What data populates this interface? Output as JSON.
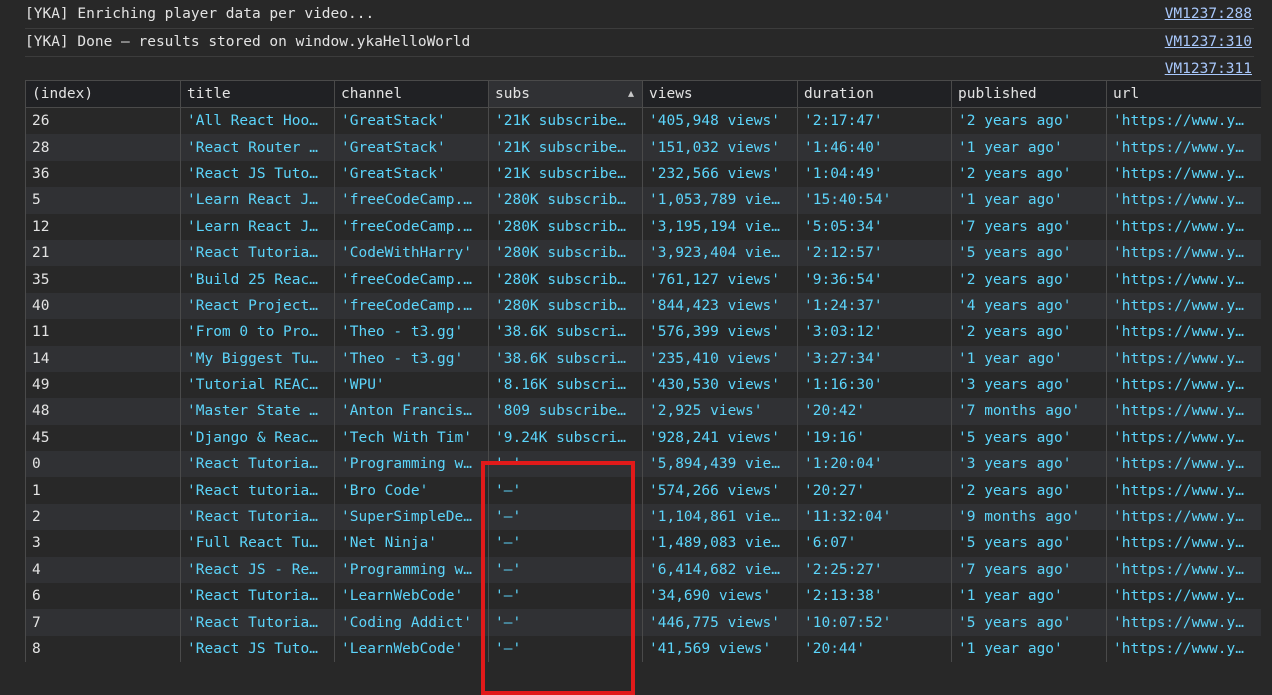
{
  "console": {
    "lines": [
      {
        "text": "[YKA] Enriching player data per video...",
        "source": "VM1237:288"
      },
      {
        "text": "[YKA] Done — results stored on window.ykaHelloWorld",
        "source": "VM1237:310"
      },
      {
        "text": "",
        "source": "VM1237:311"
      }
    ]
  },
  "table": {
    "columns": [
      "(index)",
      "title",
      "channel",
      "subs",
      "views",
      "duration",
      "published",
      "url"
    ],
    "sorted_column": "subs",
    "sort_direction": "ascending",
    "rows": [
      [
        "26",
        "'All React Hoo…",
        "'GreatStack'",
        "'21K subscribe…",
        "'405,948 views'",
        "'2:17:47'",
        "'2 years ago'",
        "'https://www.y…"
      ],
      [
        "28",
        "'React Router …",
        "'GreatStack'",
        "'21K subscribe…",
        "'151,032 views'",
        "'1:46:40'",
        "'1 year ago'",
        "'https://www.y…"
      ],
      [
        "36",
        "'React JS Tuto…",
        "'GreatStack'",
        "'21K subscribe…",
        "'232,566 views'",
        "'1:04:49'",
        "'2 years ago'",
        "'https://www.y…"
      ],
      [
        "5",
        "'Learn React J…",
        "'freeCodeCamp.…",
        "'280K subscrib…",
        "'1,053,789 vie…",
        "'15:40:54'",
        "'1 year ago'",
        "'https://www.y…"
      ],
      [
        "12",
        "'Learn React J…",
        "'freeCodeCamp.…",
        "'280K subscrib…",
        "'3,195,194 vie…",
        "'5:05:34'",
        "'7 years ago'",
        "'https://www.y…"
      ],
      [
        "21",
        "'React Tutoria…",
        "'CodeWithHarry'",
        "'280K subscrib…",
        "'3,923,404 vie…",
        "'2:12:57'",
        "'5 years ago'",
        "'https://www.y…"
      ],
      [
        "35",
        "'Build 25 Reac…",
        "'freeCodeCamp.…",
        "'280K subscrib…",
        "'761,127 views'",
        "'9:36:54'",
        "'2 years ago'",
        "'https://www.y…"
      ],
      [
        "40",
        "'React Project…",
        "'freeCodeCamp.…",
        "'280K subscrib…",
        "'844,423 views'",
        "'1:24:37'",
        "'4 years ago'",
        "'https://www.y…"
      ],
      [
        "11",
        "'From 0 to Pro…",
        "'Theo - t3.gg'",
        "'38.6K subscri…",
        "'576,399 views'",
        "'3:03:12'",
        "'2 years ago'",
        "'https://www.y…"
      ],
      [
        "14",
        "'My Biggest Tu…",
        "'Theo - t3.gg'",
        "'38.6K subscri…",
        "'235,410 views'",
        "'3:27:34'",
        "'1 year ago'",
        "'https://www.y…"
      ],
      [
        "49",
        "'Tutorial REAC…",
        "'WPU'",
        "'8.16K subscri…",
        "'430,530 views'",
        "'1:16:30'",
        "'3 years ago'",
        "'https://www.y…"
      ],
      [
        "48",
        "'Master State …",
        "'Anton Francis…",
        "'809 subscribe…",
        "'2,925 views'",
        "'20:42'",
        "'7 months ago'",
        "'https://www.y…"
      ],
      [
        "45",
        "'Django & Reac…",
        "'Tech With Tim'",
        "'9.24K subscri…",
        "'928,241 views'",
        "'19:16'",
        "'5 years ago'",
        "'https://www.y…"
      ],
      [
        "0",
        "'React Tutoria…",
        "'Programming w…",
        "'—'",
        "'5,894,439 vie…",
        "'1:20:04'",
        "'3 years ago'",
        "'https://www.y…"
      ],
      [
        "1",
        "'React tutoria…",
        "'Bro Code'",
        "'—'",
        "'574,266 views'",
        "'20:27'",
        "'2 years ago'",
        "'https://www.y…"
      ],
      [
        "2",
        "'React Tutoria…",
        "'SuperSimpleDe…",
        "'—'",
        "'1,104,861 vie…",
        "'11:32:04'",
        "'9 months ago'",
        "'https://www.y…"
      ],
      [
        "3",
        "'Full React Tu…",
        "'Net Ninja'",
        "'—'",
        "'1,489,083 vie…",
        "'6:07'",
        "'5 years ago'",
        "'https://www.y…"
      ],
      [
        "4",
        "'React JS - Re…",
        "'Programming w…",
        "'—'",
        "'6,414,682 vie…",
        "'2:25:27'",
        "'7 years ago'",
        "'https://www.y…"
      ],
      [
        "6",
        "'React Tutoria…",
        "'LearnWebCode'",
        "'—'",
        "'34,690 views'",
        "'2:13:38'",
        "'1 year ago'",
        "'https://www.y…"
      ],
      [
        "7",
        "'React Tutoria…",
        "'Coding Addict'",
        "'—'",
        "'446,775 views'",
        "'10:07:52'",
        "'5 years ago'",
        "'https://www.y…"
      ],
      [
        "8",
        "'React JS Tuto…",
        "'LearnWebCode'",
        "'—'",
        "'41,569 views'",
        "'20:44'",
        "'1 year ago'",
        "'https://www.y…"
      ]
    ]
  },
  "colors": {
    "background": "#282828",
    "string_value": "#5cd5fb",
    "link": "#a8c7fa",
    "highlight": "#e11a1a"
  }
}
